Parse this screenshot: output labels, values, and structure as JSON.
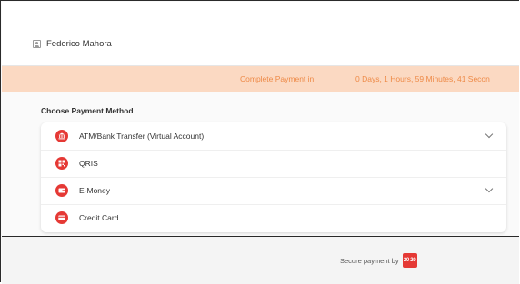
{
  "user": {
    "name": "Federico Mahora",
    "icon": "user-icon"
  },
  "countdown": {
    "label": "Complete Payment in",
    "value": "0 Days, 1 Hours, 59 Minutes, 41 Secon"
  },
  "payment": {
    "section_title": "Choose Payment Method",
    "methods": [
      {
        "label": "ATM/Bank Transfer (Virtual Account)",
        "icon": "bank-icon",
        "expandable": true
      },
      {
        "label": "QRIS",
        "icon": "qr-code-icon",
        "expandable": false
      },
      {
        "label": "E-Money",
        "icon": "wallet-icon",
        "expandable": true
      },
      {
        "label": "Credit Card",
        "icon": "credit-card-icon",
        "expandable": false
      }
    ]
  },
  "footer": {
    "secure_label": "Secure payment by",
    "logo_text": "20 20",
    "logo_icon": "payment-provider-logo"
  },
  "colors": {
    "accent": "#e53935",
    "countdown_bg": "#fbd9c2",
    "countdown_text": "#ee8a47"
  }
}
